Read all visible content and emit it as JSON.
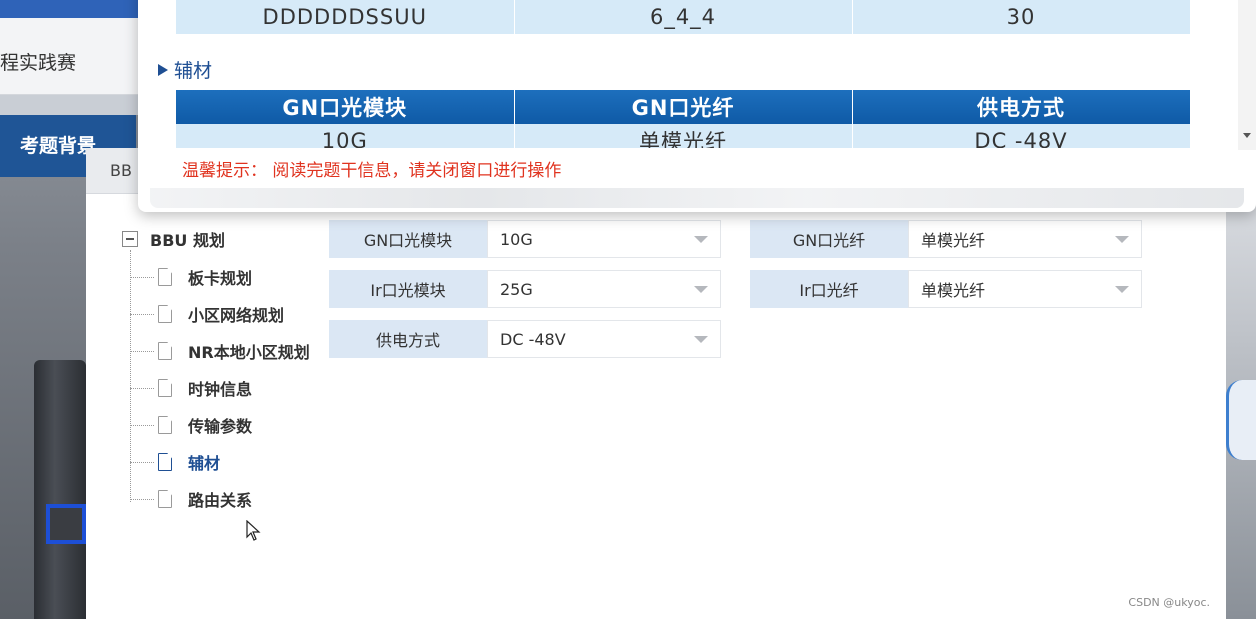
{
  "background": {
    "title_partial": "程实践赛",
    "tab_label": "考题背景"
  },
  "panel": {
    "title": "BB"
  },
  "popup": {
    "top_row": [
      "DDDDDDSSUU",
      "6_4_4",
      "30"
    ],
    "section_title": "辅材",
    "table_headers": [
      "GN口光模块",
      "GN口光纤",
      "供电方式"
    ],
    "table_row": [
      "10G",
      "单模光纤",
      "DC -48V"
    ],
    "hint": "温馨提示： 阅读完题干信息，请关闭窗口进行操作"
  },
  "tree": {
    "root_label": "BBU 规划",
    "items": [
      {
        "label": "板卡规划",
        "active": false
      },
      {
        "label": "小区网络规划",
        "active": false
      },
      {
        "label": "NR本地小区规划",
        "active": false
      },
      {
        "label": "时钟信息",
        "active": false
      },
      {
        "label": "传输参数",
        "active": false
      },
      {
        "label": "辅材",
        "active": true
      },
      {
        "label": "路由关系",
        "active": false
      }
    ]
  },
  "form": {
    "gn_module_label": "GN口光模块",
    "gn_module_value": "10G",
    "ir_module_label": "Ir口光模块",
    "ir_module_value": "25G",
    "power_label": "供电方式",
    "power_value": "DC -48V",
    "gn_fiber_label": "GN口光纤",
    "gn_fiber_value": "单模光纤",
    "ir_fiber_label": "Ir口光纤",
    "ir_fiber_value": "单模光纤"
  },
  "watermark": "CSDN @ukyoc.",
  "colors": {
    "header_blue": "#0f5aa6",
    "cell_blue": "#d6eaf8",
    "label_blue": "#dbe7f4",
    "active_blue": "#1f4f93",
    "hint_red": "#e0331f"
  }
}
